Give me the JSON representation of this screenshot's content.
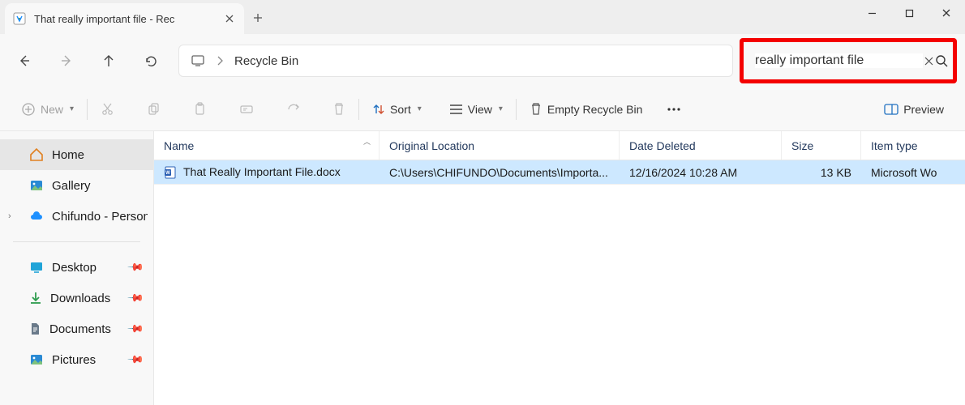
{
  "window": {
    "tab_title": "That really important file - Rec",
    "address": "Recycle Bin",
    "search_value": "really important file"
  },
  "toolbar": {
    "new": "New",
    "sort": "Sort",
    "view": "View",
    "empty": "Empty Recycle Bin",
    "preview": "Preview"
  },
  "sidebar": {
    "home": "Home",
    "gallery": "Gallery",
    "onedrive": "Chifundo - Personal",
    "desktop": "Desktop",
    "downloads": "Downloads",
    "documents": "Documents",
    "pictures": "Pictures"
  },
  "columns": {
    "name": "Name",
    "location": "Original Location",
    "date": "Date Deleted",
    "size": "Size",
    "type": "Item type"
  },
  "files": [
    {
      "name": "That Really Important File.docx",
      "location": "C:\\Users\\CHIFUNDO\\Documents\\Importa...",
      "date": "12/16/2024 10:28 AM",
      "size": "13 KB",
      "type": "Microsoft Wo"
    }
  ]
}
